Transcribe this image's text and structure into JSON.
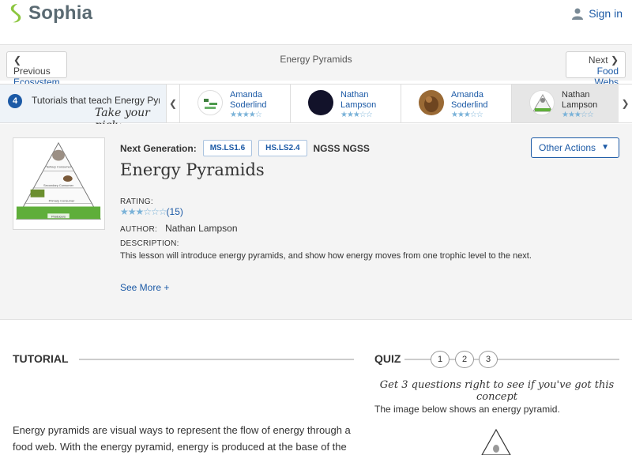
{
  "brand": {
    "name": "Sophia"
  },
  "header": {
    "signin_label": "Sign in"
  },
  "nav": {
    "prev_top": "Previous",
    "prev_sub": "Ecosystem",
    "title": "Energy Pyramids",
    "next_top": "Next",
    "next_sub": "Food Webs"
  },
  "tutorials": {
    "count": "4",
    "label": "Tutorials that teach Energy Pyramids",
    "tagline": "Take your pick:",
    "cards": [
      {
        "name_line1": "Amanda",
        "name_line2": "Soderlind",
        "rating_stars": "★★★★☆"
      },
      {
        "name_line1": "Nathan",
        "name_line2": "Lampson",
        "rating_stars": "★★★☆☆"
      },
      {
        "name_line1": "Amanda",
        "name_line2": "Soderlind",
        "rating_stars": "★★★☆☆"
      },
      {
        "name_line1": "Nathan",
        "name_line2": "Lampson",
        "rating_stars": "★★★☆☆"
      }
    ]
  },
  "lesson": {
    "ngss_label": "Next Generation:",
    "standards": [
      "MS.LS1.6",
      "HS.LS2.4"
    ],
    "ngss_tag": "NGSS NGSS",
    "actions_label": "Other Actions",
    "title": "Energy Pyramids",
    "rating_label": "RATING:",
    "stars": "★★★☆☆☆",
    "rating_count": "(15)",
    "author_label": "AUTHOR:",
    "author": "Nathan Lampson",
    "description_label": "DESCRIPTION:",
    "description": "This lesson will introduce energy pyramids, and show how energy moves from one trophic level to the next.",
    "see_more": "See More +",
    "thumbnail_labels": {
      "tertiary": "Tertiary Consumer",
      "secondary": "Secondary Consumer",
      "primary": "Primary Consumer",
      "producers": "Producers"
    }
  },
  "tutorial_section": {
    "heading": "TUTORIAL",
    "body": "Energy pyramids are visual ways to represent the flow of energy through a food web.  With the energy pyramid, energy is produced at the base of the"
  },
  "quiz": {
    "heading": "QUIZ",
    "numbers": [
      "1",
      "2",
      "3"
    ],
    "tagline": "Get 3 questions right to see if you've got this concept",
    "question": "The image below shows an energy pyramid."
  },
  "colors": {
    "link": "#1c5aa6",
    "brand_green": "#8cc63f",
    "star": "#7ab2d8"
  }
}
